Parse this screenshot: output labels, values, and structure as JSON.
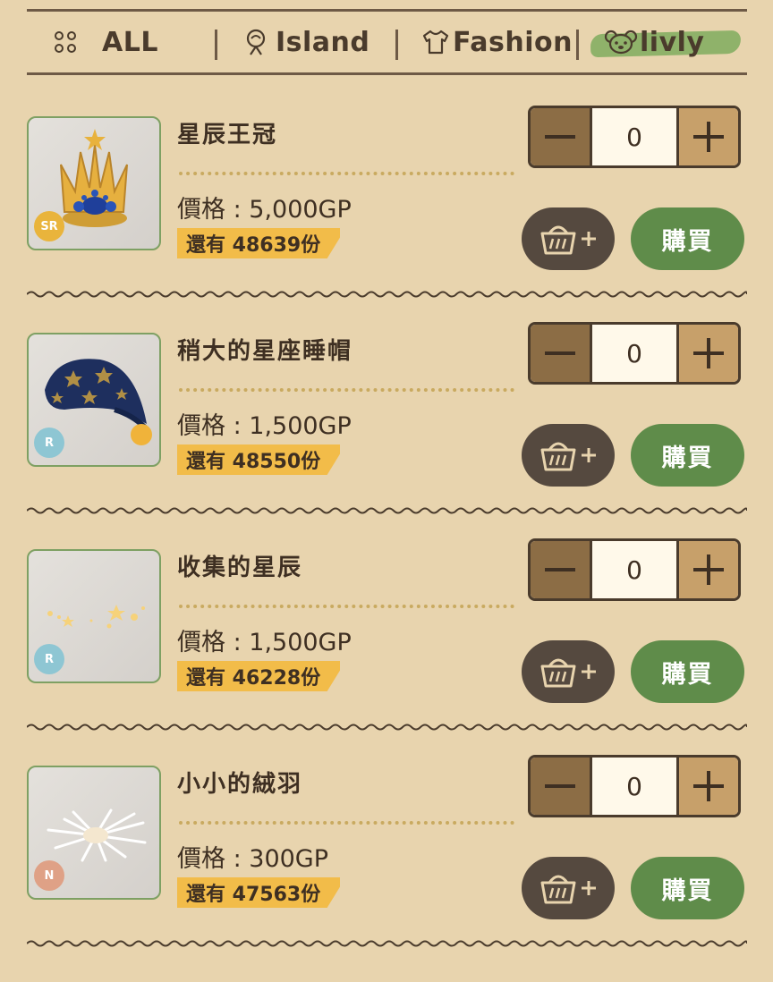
{
  "tabs": [
    {
      "label": "ALL",
      "icon": "grid-dots-icon"
    },
    {
      "label": "Island",
      "icon": "tree-icon"
    },
    {
      "label": "Fashion",
      "icon": "shirt-icon"
    },
    {
      "label": "livly",
      "icon": "livly-face-icon",
      "active": true
    }
  ],
  "items": [
    {
      "name": "星辰王冠",
      "price": "價格 : 5,000GP",
      "stock": "還有 48639份",
      "rarity": "SR",
      "rarity_color": "#e9b43c",
      "qty": "0",
      "buy_label": "購買",
      "image": "crown-icon"
    },
    {
      "name": "稍大的星座睡帽",
      "price": "價格 : 1,500GP",
      "stock": "還有 48550份",
      "rarity": "R",
      "rarity_color": "#8ec6d3",
      "qty": "0",
      "buy_label": "購買",
      "image": "night-cap-icon"
    },
    {
      "name": "收集的星辰",
      "price": "價格 : 1,500GP",
      "stock": "還有 46228份",
      "rarity": "R",
      "rarity_color": "#8ec6d3",
      "qty": "0",
      "buy_label": "購買",
      "image": "stars-sparkle-icon"
    },
    {
      "name": "小小的絨羽",
      "price": "價格 : 300GP",
      "stock": "還有 47563份",
      "rarity": "N",
      "rarity_color": "#dfa186",
      "qty": "0",
      "buy_label": "購買",
      "image": "fluff-feather-icon"
    }
  ],
  "colors": {
    "background": "#e8d4ae",
    "buy_button": "#5f8c4a",
    "stock_tag": "#f2bc49",
    "cart_button": "#55493f",
    "active_tab_highlight": "#8fb26a"
  }
}
